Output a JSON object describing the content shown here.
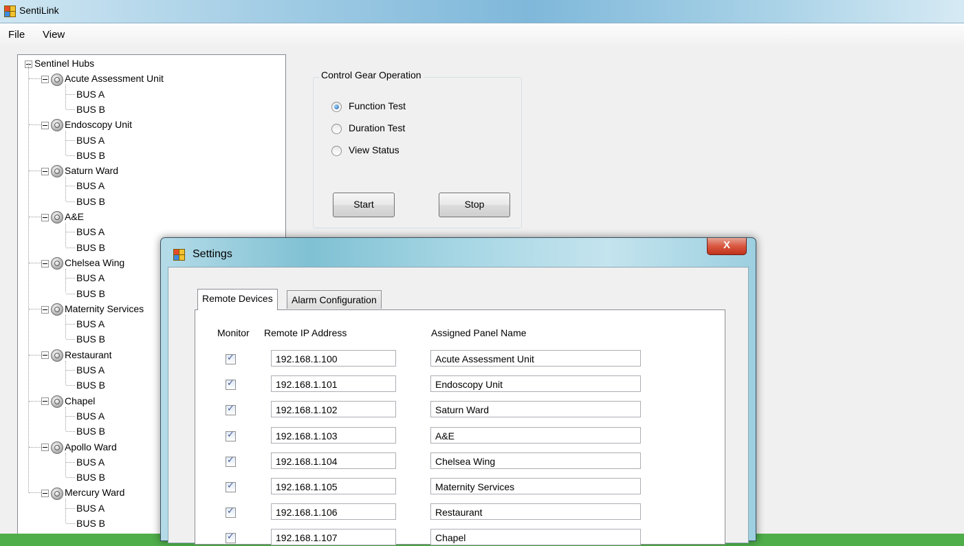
{
  "window": {
    "title": "SentiLink"
  },
  "menu": {
    "items": [
      "File",
      "View"
    ]
  },
  "tree": {
    "root": "Sentinel Hubs",
    "hubs": [
      {
        "name": "Acute Assessment Unit",
        "buses": [
          "BUS A",
          "BUS B"
        ]
      },
      {
        "name": "Endoscopy Unit",
        "buses": [
          "BUS A",
          "BUS B"
        ]
      },
      {
        "name": "Saturn Ward",
        "buses": [
          "BUS A",
          "BUS B"
        ]
      },
      {
        "name": "A&E",
        "buses": [
          "BUS A",
          "BUS B"
        ]
      },
      {
        "name": "Chelsea Wing",
        "buses": [
          "BUS A",
          "BUS B"
        ]
      },
      {
        "name": "Maternity Services",
        "buses": [
          "BUS A",
          "BUS B"
        ]
      },
      {
        "name": "Restaurant",
        "buses": [
          "BUS A",
          "BUS B"
        ]
      },
      {
        "name": "Chapel",
        "buses": [
          "BUS A",
          "BUS B"
        ]
      },
      {
        "name": "Apollo Ward",
        "buses": [
          "BUS A",
          "BUS B"
        ]
      },
      {
        "name": "Mercury Ward",
        "buses": [
          "BUS A",
          "BUS B"
        ]
      }
    ]
  },
  "control_gear": {
    "title": "Control Gear Operation",
    "options": [
      {
        "label": "Function Test",
        "checked": true
      },
      {
        "label": "Duration Test",
        "checked": false
      },
      {
        "label": "View Status",
        "checked": false
      }
    ],
    "start_label": "Start",
    "stop_label": "Stop"
  },
  "settings": {
    "title": "Settings",
    "close_label": "X",
    "tabs": [
      "Remote Devices",
      "Alarm Configuration"
    ],
    "active_tab": "Remote Devices",
    "columns": {
      "monitor": "Monitor",
      "ip": "Remote IP Address",
      "panel": "Assigned Panel Name"
    },
    "rows": [
      {
        "monitor": true,
        "ip": "192.168.1.100",
        "panel": "Acute Assessment Unit"
      },
      {
        "monitor": true,
        "ip": "192.168.1.101",
        "panel": "Endoscopy Unit"
      },
      {
        "monitor": true,
        "ip": "192.168.1.102",
        "panel": "Saturn Ward"
      },
      {
        "monitor": true,
        "ip": "192.168.1.103",
        "panel": "A&E"
      },
      {
        "monitor": true,
        "ip": "192.168.1.104",
        "panel": "Chelsea Wing"
      },
      {
        "monitor": true,
        "ip": "192.168.1.105",
        "panel": "Maternity Services"
      },
      {
        "monitor": true,
        "ip": "192.168.1.106",
        "panel": "Restaurant"
      },
      {
        "monitor": true,
        "ip": "192.168.1.107",
        "panel": "Chapel"
      }
    ]
  }
}
